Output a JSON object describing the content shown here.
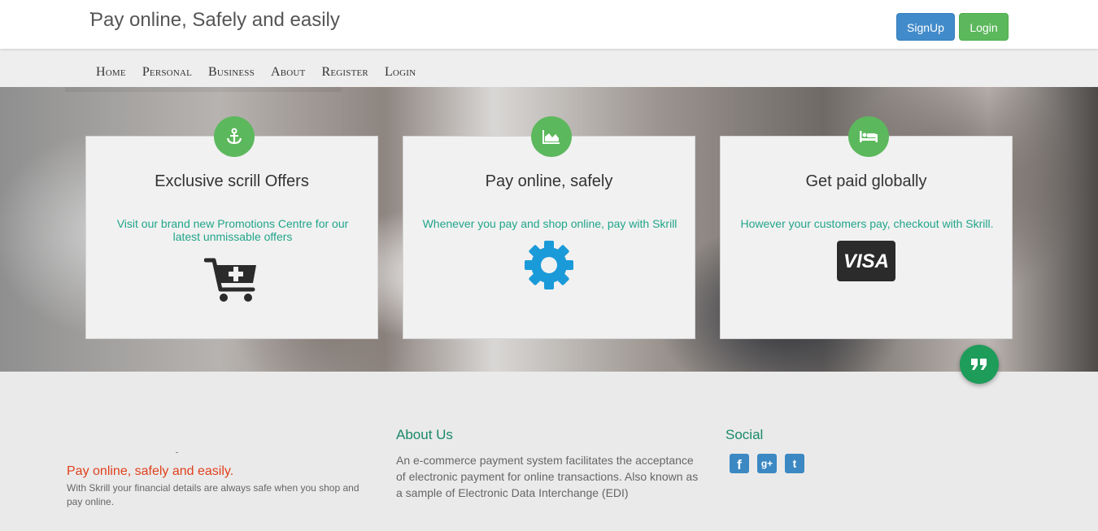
{
  "header": {
    "brand": "Pay online, Safely and easily",
    "signup_label": "SignUp",
    "login_label": "Login"
  },
  "nav": {
    "items": [
      "Home",
      "Personal",
      "Business",
      "About",
      "Register",
      "Login"
    ]
  },
  "cards": [
    {
      "icon": "anchor-icon",
      "title": "Exclusive scrill Offers",
      "text": "Visit our brand new Promotions Centre for our latest unmissable offers",
      "image": "cart-plus-icon"
    },
    {
      "icon": "area-chart-icon",
      "title": "Pay online, safely",
      "text": "Whenever you pay and shop online, pay with Skrill",
      "image": "gear-icon"
    },
    {
      "icon": "bed-icon",
      "title": "Get paid globally",
      "text": "However your customers pay, checkout with Skrill.",
      "image": "visa-icon",
      "visa_text": "VISA"
    }
  ],
  "footer": {
    "tagline": "Pay online, safely and easily.",
    "description": "With Skrill your financial details are always safe when you shop and pay online.",
    "about_title": "About Us",
    "about_text": "An e-commerce payment system facilitates the acceptance of electronic payment for online transactions. Also known as a sample of Electronic Data Interchange (EDI)",
    "social_title": "Social",
    "social": [
      "facebook-icon",
      "google-plus-icon",
      "twitter-icon"
    ],
    "social_glyphs": [
      "f",
      "g+",
      "t"
    ]
  },
  "colors": {
    "primary": "#428bca",
    "success": "#5cb85c",
    "accent_text": "#21a58a",
    "tagline": "#e0401c",
    "heading_green": "#1a8a6a",
    "gear_blue": "#1a9ad9"
  }
}
